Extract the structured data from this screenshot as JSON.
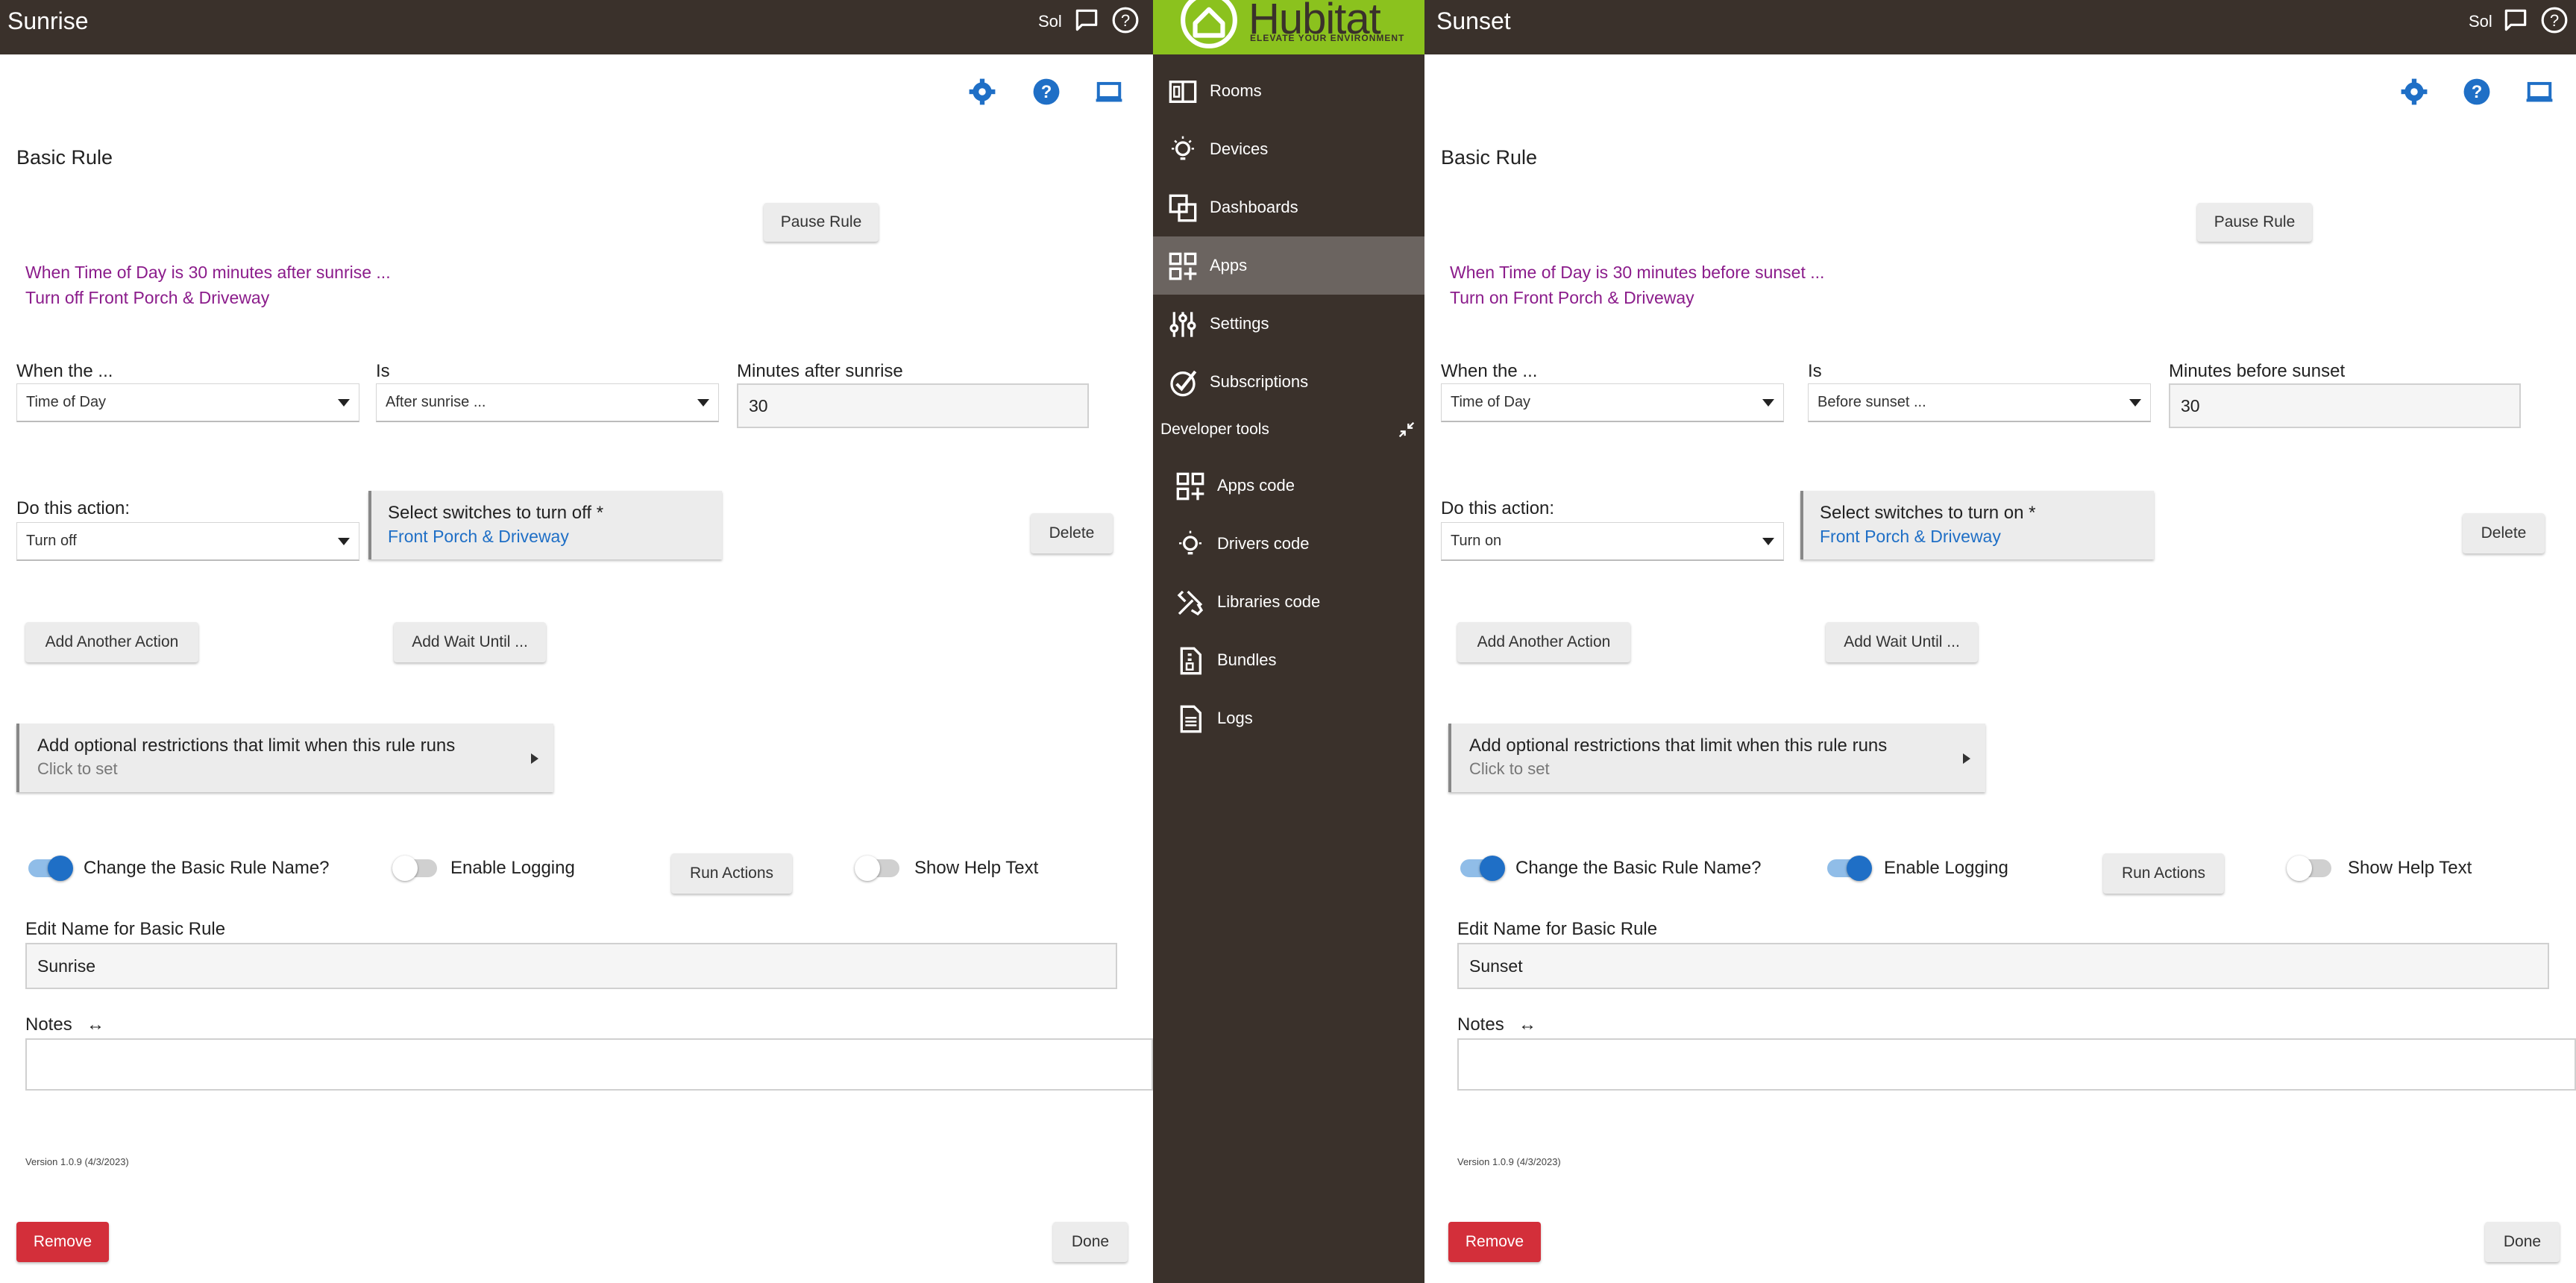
{
  "header": {
    "user": "Sol",
    "chat_icon": "chat-bubble-icon",
    "help_icon": "help-circle-icon"
  },
  "sidebar": {
    "logo_text": "Hubitat",
    "logo_tagline": "ELEVATE YOUR ENVIRONMENT",
    "items": [
      {
        "label": "Rooms",
        "icon": "rooms-icon"
      },
      {
        "label": "Devices",
        "icon": "bulb-icon"
      },
      {
        "label": "Dashboards",
        "icon": "dashboards-icon"
      },
      {
        "label": "Apps",
        "icon": "apps-icon",
        "active": true
      },
      {
        "label": "Settings",
        "icon": "sliders-icon"
      },
      {
        "label": "Subscriptions",
        "icon": "check-circle-icon"
      }
    ],
    "dev_tools_label": "Developer tools",
    "dev_items": [
      {
        "label": "Apps code",
        "icon": "apps-code-icon"
      },
      {
        "label": "Drivers code",
        "icon": "bulb-icon"
      },
      {
        "label": "Libraries code",
        "icon": "tools-icon"
      },
      {
        "label": "Bundles",
        "icon": "bundle-icon"
      },
      {
        "label": "Logs",
        "icon": "document-icon"
      }
    ]
  },
  "panels": [
    {
      "title": "Sunrise",
      "section_title": "Basic Rule",
      "pause_label": "Pause Rule",
      "summary_line1": "When Time of Day is 30 minutes after sunrise  ...",
      "summary_line2": "Turn off Front Porch & Driveway",
      "when_label": "When the ...",
      "when_value": "Time of Day",
      "is_label": "Is",
      "is_value": "After sunrise ...",
      "minutes_label": "Minutes after sunrise",
      "minutes_value": "30",
      "action_label": "Do this action:",
      "action_value": "Turn off",
      "switch_label": "Select switches to turn off *",
      "switch_value": "Front Porch & Driveway",
      "delete_label": "Delete",
      "add_action_label": "Add Another Action",
      "add_wait_label": "Add Wait Until ...",
      "restrict_label": "Add optional restrictions that limit when this rule runs",
      "restrict_sub": "Click to set",
      "toggle_name_label": "Change the Basic Rule Name?",
      "toggle_name_on": true,
      "toggle_logging_label": "Enable Logging",
      "toggle_logging_on": false,
      "run_actions_label": "Run Actions",
      "toggle_help_label": "Show Help Text",
      "toggle_help_on": false,
      "edit_name_label": "Edit Name for Basic Rule",
      "edit_name_value": "Sunrise",
      "notes_label": "Notes",
      "notes_icon": "↔",
      "version": "Version 1.0.9 (4/3/2023)",
      "remove_label": "Remove",
      "done_label": "Done"
    },
    {
      "title": "Sunset",
      "section_title": "Basic Rule",
      "pause_label": "Pause Rule",
      "summary_line1": "When Time of Day is 30 minutes before sunset ...",
      "summary_line2": "Turn on Front Porch & Driveway",
      "when_label": "When the ...",
      "when_value": "Time of Day",
      "is_label": "Is",
      "is_value": "Before sunset ...",
      "minutes_label": "Minutes before sunset",
      "minutes_value": "30",
      "action_label": "Do this action:",
      "action_value": "Turn on",
      "switch_label": "Select switches to turn on *",
      "switch_value": "Front Porch & Driveway",
      "delete_label": "Delete",
      "add_action_label": "Add Another Action",
      "add_wait_label": "Add Wait Until ...",
      "restrict_label": "Add optional restrictions that limit when this rule runs",
      "restrict_sub": "Click to set",
      "toggle_name_label": "Change the Basic Rule Name?",
      "toggle_name_on": true,
      "toggle_logging_label": "Enable Logging",
      "toggle_logging_on": true,
      "run_actions_label": "Run Actions",
      "toggle_help_label": "Show Help Text",
      "toggle_help_on": false,
      "edit_name_label": "Edit Name for Basic Rule",
      "edit_name_value": "Sunset",
      "notes_label": "Notes",
      "notes_icon": "↔",
      "version": "Version 1.0.9 (4/3/2023)",
      "remove_label": "Remove",
      "done_label": "Done"
    }
  ],
  "colors": {
    "header_bg": "#3a312b",
    "logo_green": "#8bc21e",
    "accent_blue": "#1f6fc6",
    "summary_purple": "#8b1c8b",
    "remove_red": "#d32f3a"
  }
}
